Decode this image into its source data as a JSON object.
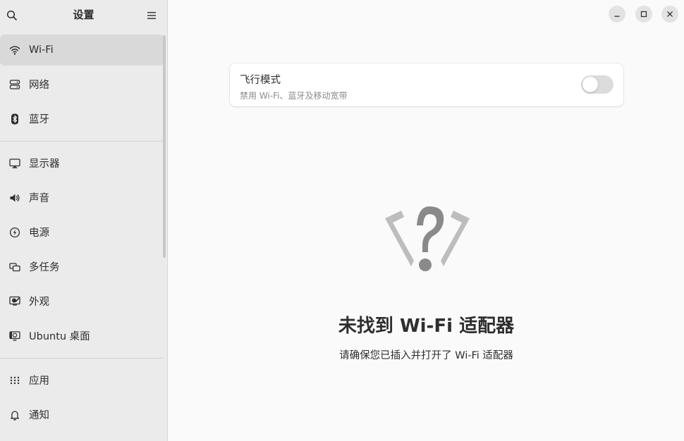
{
  "sidebar": {
    "title": "设置",
    "items": [
      {
        "label": "Wi-Fi",
        "icon": "wifi-icon",
        "active": true
      },
      {
        "label": "网络",
        "icon": "network-icon"
      },
      {
        "label": "蓝牙",
        "icon": "bluetooth-icon"
      },
      {
        "label": "显示器",
        "icon": "display-icon"
      },
      {
        "label": "声音",
        "icon": "speaker-icon"
      },
      {
        "label": "电源",
        "icon": "power-icon"
      },
      {
        "label": "多任务",
        "icon": "multitasking-icon"
      },
      {
        "label": "外观",
        "icon": "appearance-icon"
      },
      {
        "label": "Ubuntu 桌面",
        "icon": "ubuntu-desktop-icon"
      },
      {
        "label": "应用",
        "icon": "apps-grid-icon"
      },
      {
        "label": "通知",
        "icon": "bell-icon"
      }
    ]
  },
  "airplane": {
    "title": "飞行模式",
    "subtitle": "禁用 Wi-Fi、蓝牙及移动宽带",
    "enabled": false
  },
  "empty_state": {
    "title": "未找到 Wi-Fi 适配器",
    "subtitle": "请确保您已插入并打开了 Wi-Fi 适配器",
    "icon": "wifi-unknown-icon"
  },
  "colors": {
    "sidebar_bg": "#ebebeb",
    "main_bg": "#fafafa",
    "active_item": "#d9d9d9"
  }
}
